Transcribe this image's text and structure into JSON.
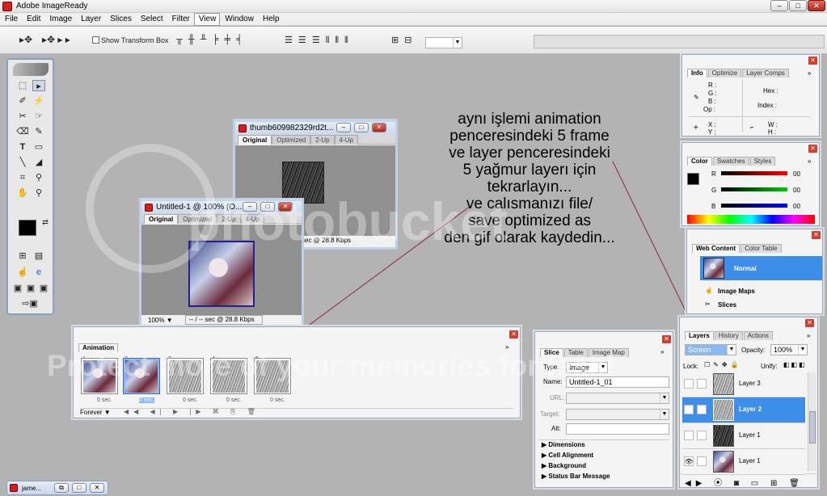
{
  "app": {
    "title": "Adobe ImageReady"
  },
  "menu": [
    "File",
    "Edit",
    "Image",
    "Layer",
    "Slices",
    "Select",
    "Filter",
    "View",
    "Window",
    "Help"
  ],
  "options": {
    "show_transform_box": "Show Transform Box"
  },
  "doc_thumb": {
    "title": "thumb609982329rd2t...",
    "tabs": [
      "Original",
      "Optimized",
      "2-Up",
      "4-Up"
    ],
    "status": "sec @ 28.8 Kbps"
  },
  "doc_untitled": {
    "title": "Untitled-1 @ 100% (O...",
    "tabs": [
      "Original",
      "Optimized",
      "2-Up",
      "4-Up"
    ],
    "zoom": "100%",
    "status": "-- / -- sec @ 28.8 Kbps"
  },
  "note": {
    "lines": [
      "aynı işlemi animation",
      "penceresindeki 5 frame",
      "ve layer penceresindeki",
      "5 yağmur layerı için",
      "tekrarlayın...",
      "ve calısmanızı file/",
      "save optimized as",
      "den gif olarak kaydedin..."
    ]
  },
  "info_panel": {
    "tabs": [
      "Info",
      "Optimize",
      "Layer Comps"
    ],
    "labels": {
      "r": "R :",
      "g": "G :",
      "b": "B :",
      "op": "Op :",
      "hex": "Hex :",
      "index": "Index :",
      "x": "X :",
      "y": "Y :",
      "w": "W :",
      "h": "H :"
    }
  },
  "color_panel": {
    "tabs": [
      "Color",
      "Swatches",
      "Styles"
    ],
    "channels": [
      {
        "name": "R",
        "value": "00"
      },
      {
        "name": "G",
        "value": "00"
      },
      {
        "name": "B",
        "value": "00"
      }
    ]
  },
  "web_panel": {
    "tabs": [
      "Web Content",
      "Color Table"
    ],
    "items": [
      "Normal",
      "Image Maps",
      "Slices"
    ]
  },
  "animation_panel": {
    "title": "Animation",
    "frames": [
      {
        "num": "1",
        "delay": "0 sec."
      },
      {
        "num": "2",
        "delay": "0 sec."
      },
      {
        "num": "3",
        "delay": "0 sec."
      },
      {
        "num": "4",
        "delay": "0 sec."
      },
      {
        "num": "5",
        "delay": "0 sec."
      }
    ],
    "loop": "Forever"
  },
  "slice_panel": {
    "tabs": [
      "Slice",
      "Table",
      "Image Map"
    ],
    "type_label": "Type:",
    "type_value": "Image",
    "name_label": "Name:",
    "name_value": "Untitled-1_01",
    "url_label": "URL:",
    "target_label": "Target:",
    "alt_label": "Alt:",
    "sections": [
      "Dimensions",
      "Cell Alignment",
      "Background",
      "Status Bar Message"
    ]
  },
  "layers_panel": {
    "tabs": [
      "Layers",
      "History",
      "Actions"
    ],
    "blend_mode": "Screen",
    "opacity_label": "Opacity:",
    "opacity_value": "100%",
    "lock_label": "Lock:",
    "unify_label": "Unify:",
    "layers": [
      "Layer 3",
      "Layer 2",
      "Layer 1",
      "Layer 1"
    ]
  },
  "taskbar": {
    "item": "jame..."
  },
  "watermark": {
    "logo": "photobucket",
    "text": "Protect more of your memories for less!"
  }
}
